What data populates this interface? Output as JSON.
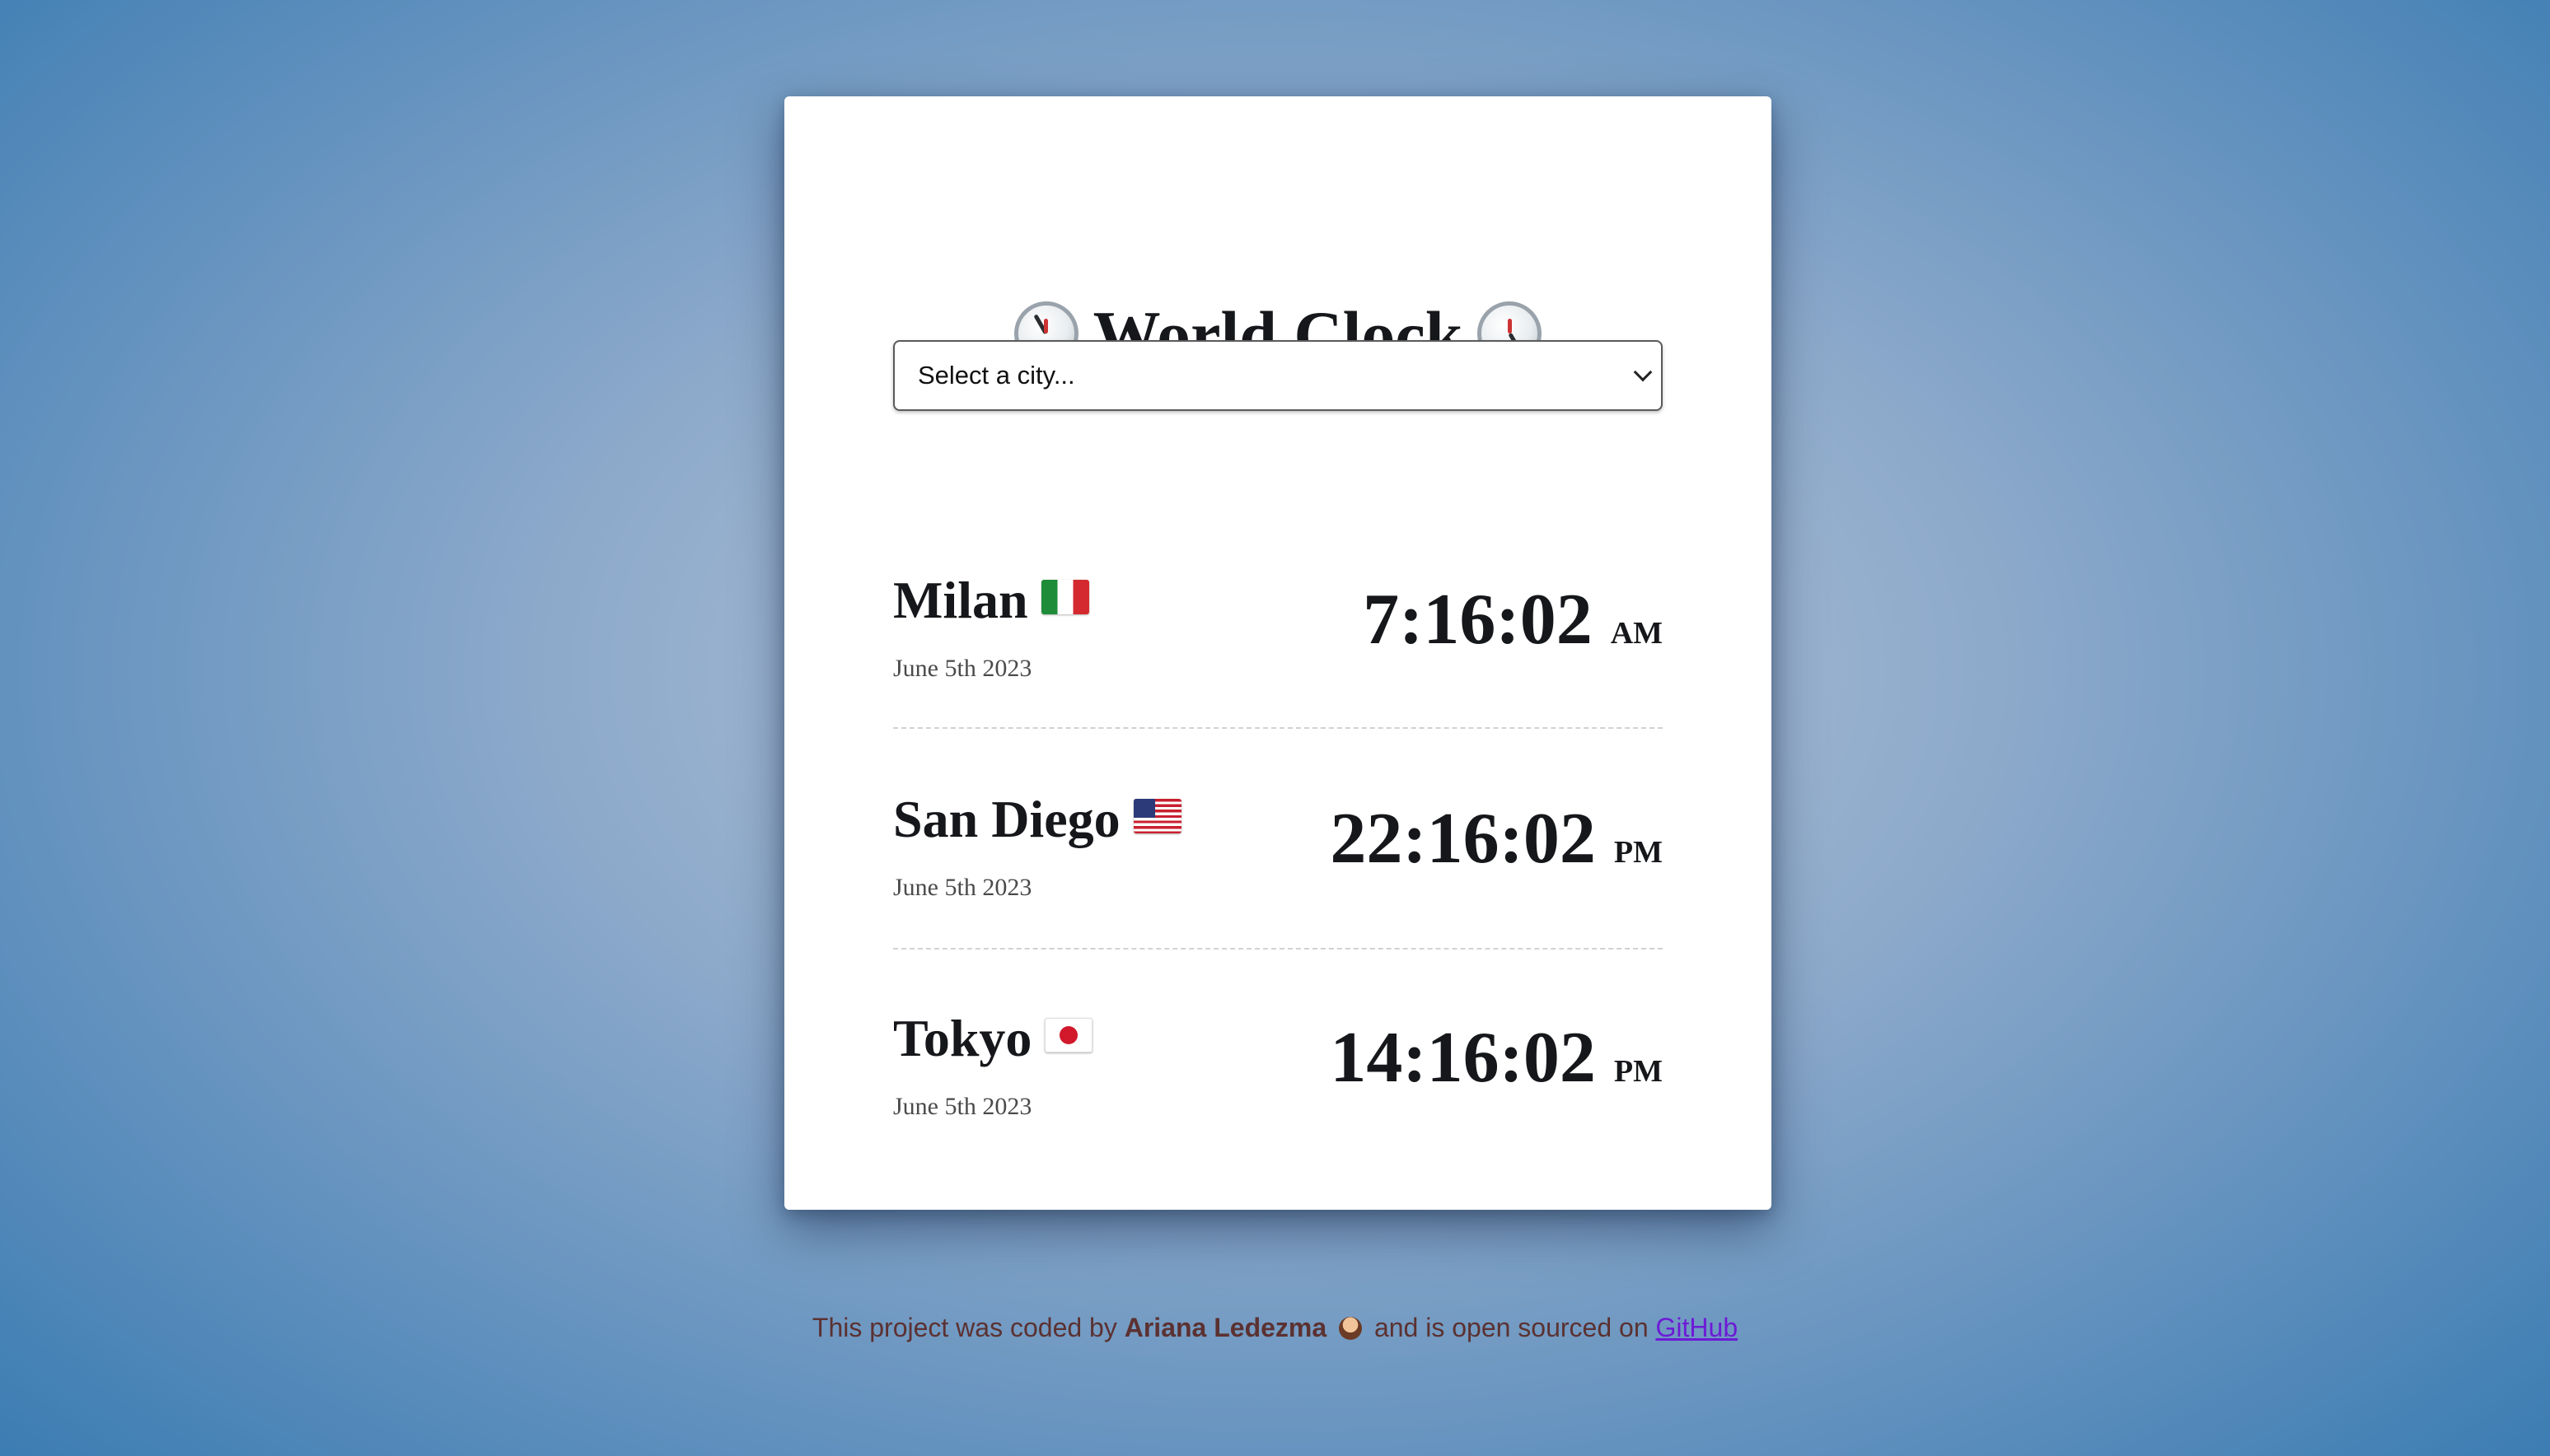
{
  "app": {
    "title": "World Clock",
    "title_icon_left": "clock-icon",
    "title_icon_right": "clock-icon"
  },
  "city_select": {
    "selected_label": "Select a city..."
  },
  "cities": [
    {
      "name": "Milan",
      "flag": "italy-flag-icon",
      "date": "June 5th 2023",
      "time": "7:16:02",
      "period": "AM"
    },
    {
      "name": "San Diego",
      "flag": "usa-flag-icon",
      "date": "June 5th 2023",
      "time": "22:16:02",
      "period": "PM"
    },
    {
      "name": "Tokyo",
      "flag": "japan-flag-icon",
      "date": "June 5th 2023",
      "time": "14:16:02",
      "period": "PM"
    }
  ],
  "footer": {
    "prefix": "This project was coded by",
    "author": "Ariana Ledezma",
    "author_icon": "coder-icon",
    "middle": "and is open sourced on",
    "link_label": "GitHub"
  },
  "colors": {
    "text": "#15171a",
    "footer_text": "#5b3131",
    "link": "#6d1bd6"
  }
}
